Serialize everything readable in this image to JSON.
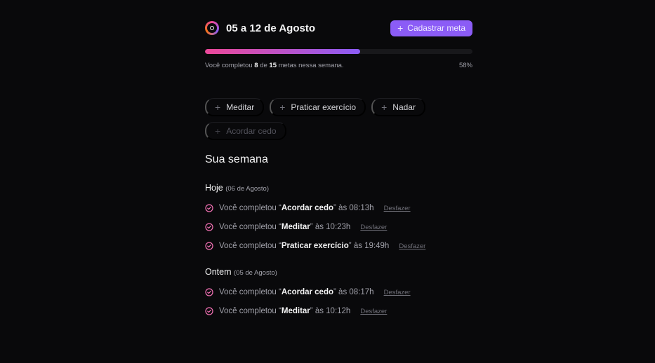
{
  "header": {
    "title": "05 a 12 de Agosto",
    "add_goal_label": "Cadastrar meta"
  },
  "progress": {
    "completed": "8",
    "total": "15",
    "prefix": "Você completou",
    "middle": "de",
    "suffix": "metas nessa semana.",
    "percent_label": "58%",
    "percent_value": 58,
    "gradient_start": "#ec4899",
    "gradient_end": "#8b5cf6"
  },
  "suggestions": [
    {
      "label": "Meditar",
      "disabled": false
    },
    {
      "label": "Praticar exercício",
      "disabled": false
    },
    {
      "label": "Nadar",
      "disabled": false
    },
    {
      "label": "Acordar cedo",
      "disabled": true
    }
  ],
  "week": {
    "title": "Sua semana",
    "days": [
      {
        "label": "Hoje",
        "date": "(06 de Agosto)",
        "entries": [
          {
            "prefix": "Você completou",
            "goal": "Acordar cedo",
            "time": "às 08:13h",
            "undo": "Desfazer"
          },
          {
            "prefix": "Você completou",
            "goal": "Meditar",
            "time": "às 10:23h",
            "undo": "Desfazer"
          },
          {
            "prefix": "Você completou",
            "goal": "Praticar exercício",
            "time": "às 19:49h",
            "undo": "Desfazer"
          }
        ]
      },
      {
        "label": "Ontem",
        "date": "(05 de Agosto)",
        "entries": [
          {
            "prefix": "Você completou",
            "goal": "Acordar cedo",
            "time": "às 08:17h",
            "undo": "Desfazer"
          },
          {
            "prefix": "Você completou",
            "goal": "Meditar",
            "time": "às 10:12h",
            "undo": "Desfazer"
          }
        ]
      }
    ]
  },
  "icons": {
    "logo": "logo-icon",
    "plus": "plus-icon",
    "check": "check-circle-icon"
  },
  "colors": {
    "accent": "#8b5cf6",
    "check": "#f472b6",
    "background": "#09090b"
  }
}
